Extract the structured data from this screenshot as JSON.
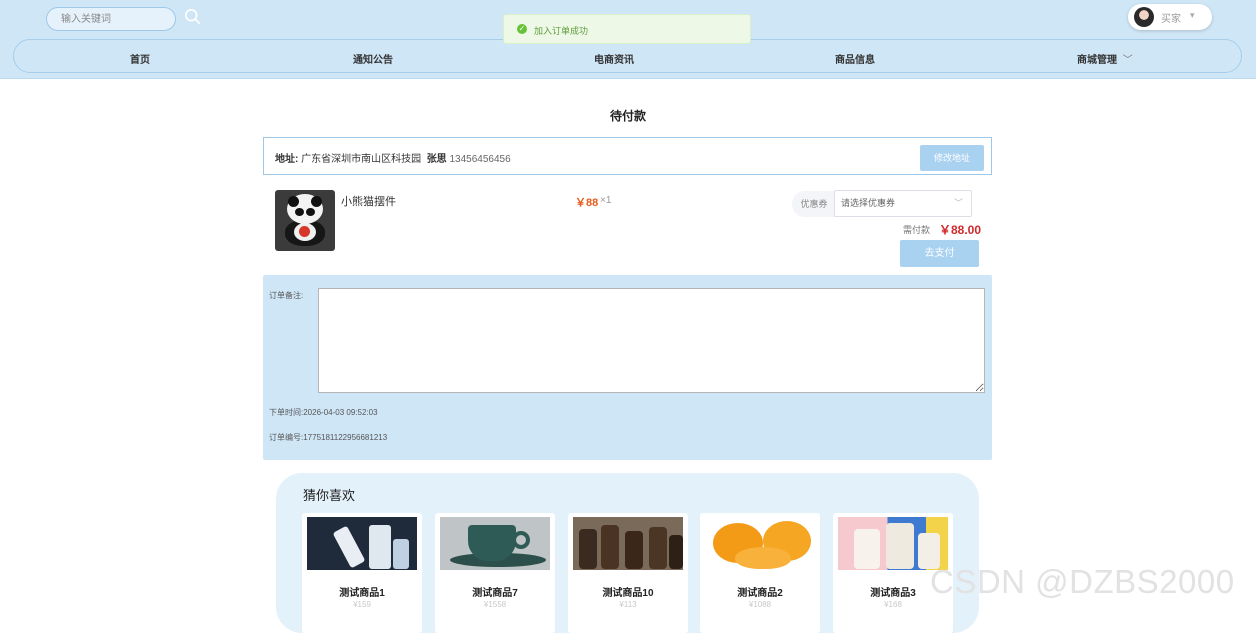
{
  "header": {
    "search_placeholder": "输入关键词",
    "user_name": "买家",
    "nav": [
      {
        "label": "首页"
      },
      {
        "label": "通知公告"
      },
      {
        "label": "电商资讯"
      },
      {
        "label": "商品信息"
      },
      {
        "label": "商城管理"
      }
    ]
  },
  "toast": {
    "message": "加入订单成功"
  },
  "page": {
    "title": "待付款"
  },
  "address": {
    "label": "地址:",
    "value": "广东省深圳市南山区科技园",
    "contact_name": "张思",
    "phone": "13456456456",
    "edit_button": "修改地址"
  },
  "order_item": {
    "name": "小熊猫摆件",
    "price": "￥88",
    "qty": "×1",
    "coupon_label": "优惠券",
    "coupon_placeholder": "请选择优惠券",
    "due_label": "需付款",
    "due_value": "￥88.00",
    "pay_button": "去支付"
  },
  "remark": {
    "label": "订单备注:",
    "value": "",
    "order_time_label": "下单时间:",
    "order_time": "2026-04-03 09:52:03",
    "order_no_label": "订单编号:",
    "order_no": "1775181122956681213"
  },
  "recommend": {
    "title": "猜你喜欢",
    "items": [
      {
        "name": "测试商品1",
        "price": "¥159"
      },
      {
        "name": "测试商品7",
        "price": "¥1558"
      },
      {
        "name": "测试商品10",
        "price": "¥113"
      },
      {
        "name": "测试商品2",
        "price": "¥1088"
      },
      {
        "name": "测试商品3",
        "price": "¥168"
      }
    ]
  },
  "watermark": "CSDN @DZBS2000",
  "colors": {
    "header_bg": "#cfe6f7",
    "accent": "#a9d1f0",
    "price": "#e45b1b",
    "due": "#d1282b",
    "success": "#67c23a"
  }
}
